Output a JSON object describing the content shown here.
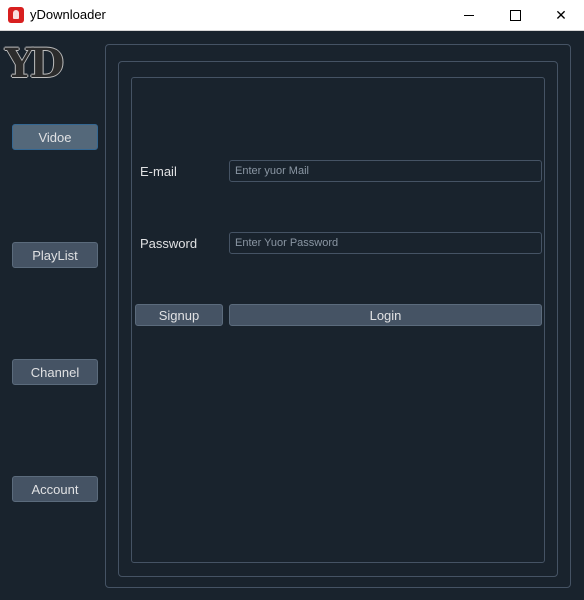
{
  "window": {
    "title": "yDownloader",
    "minimize_glyph": "",
    "close_glyph": "✕"
  },
  "logo": {
    "text": "YD"
  },
  "sidebar": {
    "items": [
      {
        "label": "Vidoe"
      },
      {
        "label": "PlayList"
      },
      {
        "label": "Channel"
      },
      {
        "label": "Account"
      }
    ]
  },
  "form": {
    "email_label": "E-mail",
    "email_placeholder": "Enter yuor Mail",
    "email_value": "",
    "password_label": "Password",
    "password_placeholder": "Enter Yuor Password",
    "password_value": "",
    "signup_label": "Signup",
    "login_label": "Login"
  },
  "colors": {
    "background": "#19232d",
    "border": "#455364",
    "button": "#455364",
    "accent": "#346792",
    "text": "#e0e1e3"
  }
}
